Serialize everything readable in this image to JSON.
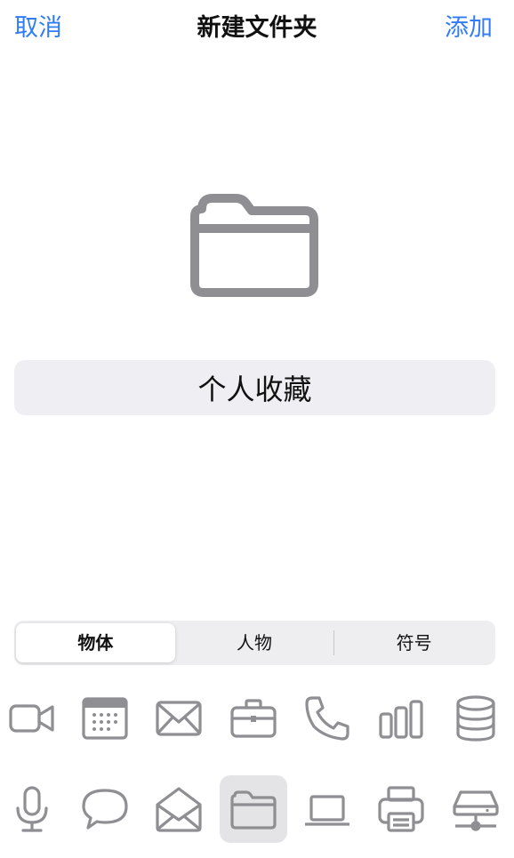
{
  "nav": {
    "cancel_label": "取消",
    "title": "新建文件夹",
    "add_label": "添加"
  },
  "folder_name": {
    "value": "个人收藏"
  },
  "segments": {
    "items": [
      {
        "label": "物体",
        "selected": true
      },
      {
        "label": "人物",
        "selected": false
      },
      {
        "label": "符号",
        "selected": false
      }
    ]
  },
  "icon_palette": {
    "row1": [
      "video-camera-icon",
      "calendar-icon",
      "envelope-icon",
      "briefcase-icon",
      "phone-icon",
      "bar-chart-icon",
      "database-icon"
    ],
    "row2": [
      "microphone-icon",
      "speech-bubble-icon",
      "open-envelope-icon",
      "folder-icon",
      "laptop-icon",
      "printer-icon",
      "network-drive-icon"
    ],
    "selected_icon": "folder-icon"
  },
  "colors": {
    "accent": "#2f7cf6",
    "icon_gray": "#8e8e93",
    "field_bg": "#eeeef3",
    "selected_cell_bg": "#e4e4e6"
  }
}
